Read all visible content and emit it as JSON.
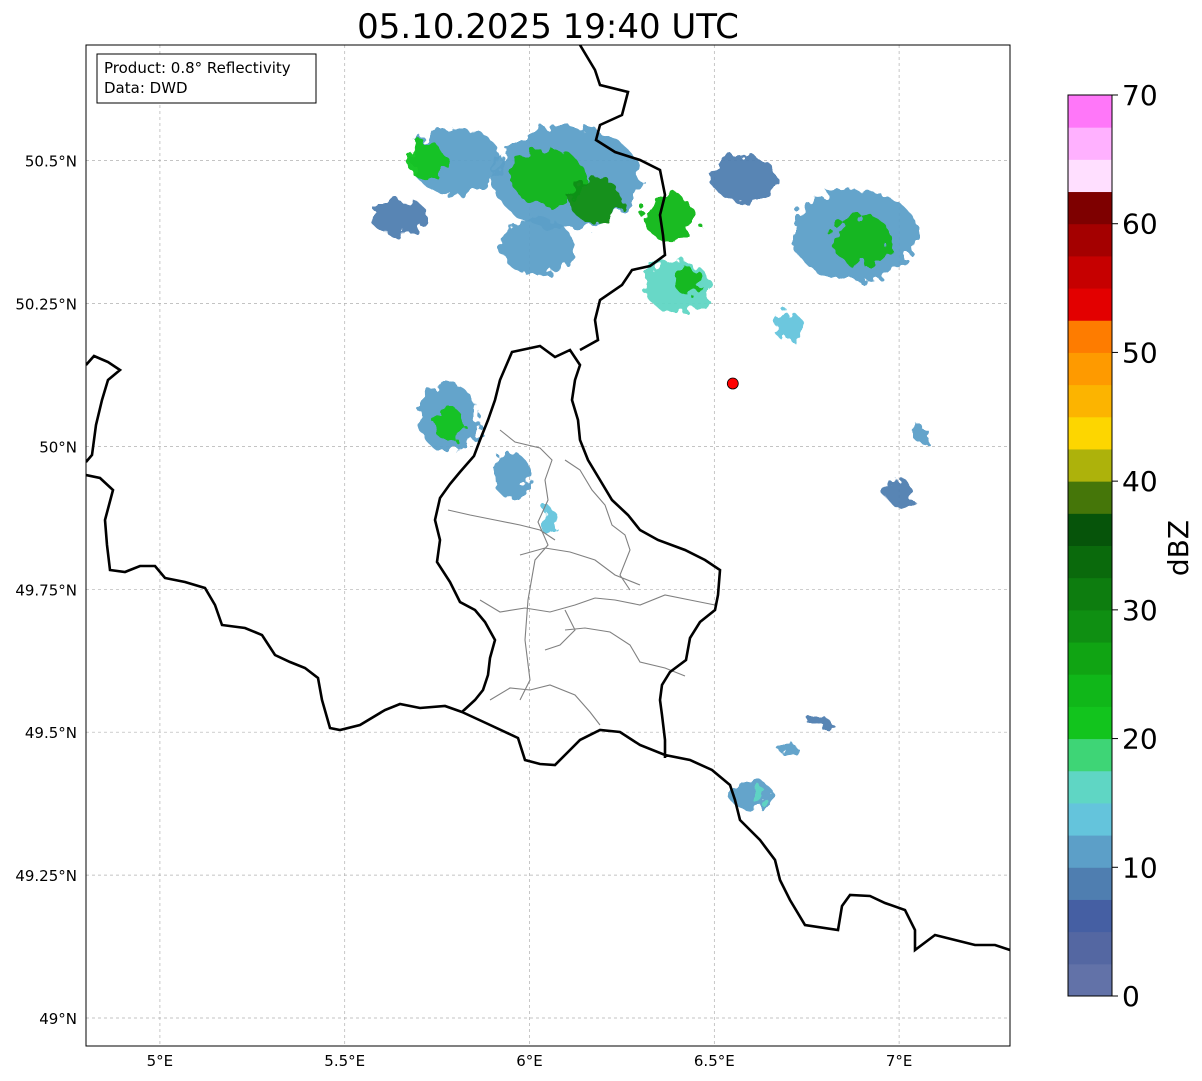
{
  "title": "05.10.2025 19:40 UTC",
  "info_box": {
    "product_line": "Product: 0.8° Reflectivity",
    "data_line": "Data: DWD"
  },
  "x_ticks": [
    {
      "value": 5.0,
      "label": "5°E"
    },
    {
      "value": 5.5,
      "label": "5.5°E"
    },
    {
      "value": 6.0,
      "label": "6°E"
    },
    {
      "value": 6.5,
      "label": "6.5°E"
    },
    {
      "value": 7.0,
      "label": "7°E"
    }
  ],
  "y_ticks": [
    {
      "value": 49.0,
      "label": "49°N"
    },
    {
      "value": 49.25,
      "label": "49.25°N"
    },
    {
      "value": 49.5,
      "label": "49.5°N"
    },
    {
      "value": 49.75,
      "label": "49.75°N"
    },
    {
      "value": 50.0,
      "label": "50°N"
    },
    {
      "value": 50.25,
      "label": "50.25°N"
    },
    {
      "value": 50.5,
      "label": "50.5°N"
    }
  ],
  "map_extent": {
    "lon_min": 4.8,
    "lon_max": 7.3,
    "lat_min": 48.95,
    "lat_max": 50.7
  },
  "radar_site": {
    "lon": 6.55,
    "lat": 50.11,
    "color": "#ff0000"
  },
  "colorbar": {
    "label": "dBZ",
    "min": 0,
    "max": 70,
    "step": 2.5,
    "tick_labels": [
      "0",
      "10",
      "20",
      "30",
      "40",
      "50",
      "60",
      "70"
    ],
    "colors": [
      "#6272a8",
      "#5467a2",
      "#455fa3",
      "#4f7eb0",
      "#5c9fc8",
      "#64c4dc",
      "#5fd6c4",
      "#3ed576",
      "#12c41d",
      "#10b719",
      "#10a413",
      "#0f8f12",
      "#0d7d0f",
      "#0a6a0c",
      "#06540a",
      "#457609",
      "#adb20b",
      "#fdd600",
      "#fcb400",
      "#fe9a00",
      "#fe7c00",
      "#e30000",
      "#c60000",
      "#a40000",
      "#7e0000",
      "#ffdfff",
      "#ffb1ff",
      "#ff77f9",
      "#e73ded"
    ]
  },
  "colors": {
    "country_border": "#000000",
    "district_border": "#808080",
    "grid": "#b0b0b0"
  },
  "echo_cells": [
    {
      "lon": 5.8,
      "lat": 50.5,
      "rlon": 0.12,
      "rlat": 0.06,
      "dbz": 12
    },
    {
      "lon": 5.72,
      "lat": 50.5,
      "rlon": 0.05,
      "rlat": 0.035,
      "dbz": 22
    },
    {
      "lon": 6.1,
      "lat": 50.47,
      "rlon": 0.2,
      "rlat": 0.09,
      "dbz": 12
    },
    {
      "lon": 6.05,
      "lat": 50.47,
      "rlon": 0.1,
      "rlat": 0.05,
      "dbz": 23
    },
    {
      "lon": 6.18,
      "lat": 50.43,
      "rlon": 0.07,
      "rlat": 0.04,
      "dbz": 28
    },
    {
      "lon": 5.65,
      "lat": 50.4,
      "rlon": 0.08,
      "rlat": 0.03,
      "dbz": 8
    },
    {
      "lon": 6.02,
      "lat": 50.35,
      "rlon": 0.1,
      "rlat": 0.05,
      "dbz": 10
    },
    {
      "lon": 6.38,
      "lat": 50.4,
      "rlon": 0.07,
      "rlat": 0.04,
      "dbz": 24
    },
    {
      "lon": 6.4,
      "lat": 50.28,
      "rlon": 0.09,
      "rlat": 0.045,
      "dbz": 15
    },
    {
      "lon": 6.43,
      "lat": 50.29,
      "rlon": 0.04,
      "rlat": 0.025,
      "dbz": 24
    },
    {
      "lon": 6.58,
      "lat": 50.47,
      "rlon": 0.09,
      "rlat": 0.04,
      "dbz": 8
    },
    {
      "lon": 6.7,
      "lat": 50.21,
      "rlon": 0.04,
      "rlat": 0.025,
      "dbz": 14
    },
    {
      "lon": 6.88,
      "lat": 50.37,
      "rlon": 0.17,
      "rlat": 0.08,
      "dbz": 12
    },
    {
      "lon": 6.9,
      "lat": 50.36,
      "rlon": 0.08,
      "rlat": 0.045,
      "dbz": 24
    },
    {
      "lon": 5.78,
      "lat": 50.05,
      "rlon": 0.08,
      "rlat": 0.06,
      "dbz": 12
    },
    {
      "lon": 5.78,
      "lat": 50.04,
      "rlon": 0.04,
      "rlat": 0.03,
      "dbz": 21
    },
    {
      "lon": 5.95,
      "lat": 49.95,
      "rlon": 0.05,
      "rlat": 0.04,
      "dbz": 10
    },
    {
      "lon": 6.05,
      "lat": 49.87,
      "rlon": 0.02,
      "rlat": 0.025,
      "dbz": 14
    },
    {
      "lon": 7.06,
      "lat": 50.02,
      "rlon": 0.02,
      "rlat": 0.015,
      "dbz": 10
    },
    {
      "lon": 7.0,
      "lat": 49.92,
      "rlon": 0.035,
      "rlat": 0.025,
      "dbz": 8
    },
    {
      "lon": 6.6,
      "lat": 49.39,
      "rlon": 0.06,
      "rlat": 0.025,
      "dbz": 10
    },
    {
      "lon": 6.62,
      "lat": 49.39,
      "rlon": 0.02,
      "rlat": 0.015,
      "dbz": 17
    },
    {
      "lon": 6.78,
      "lat": 49.52,
      "rlon": 0.03,
      "rlat": 0.01,
      "dbz": 9
    },
    {
      "lon": 6.7,
      "lat": 49.47,
      "rlon": 0.025,
      "rlat": 0.01,
      "dbz": 12
    }
  ]
}
